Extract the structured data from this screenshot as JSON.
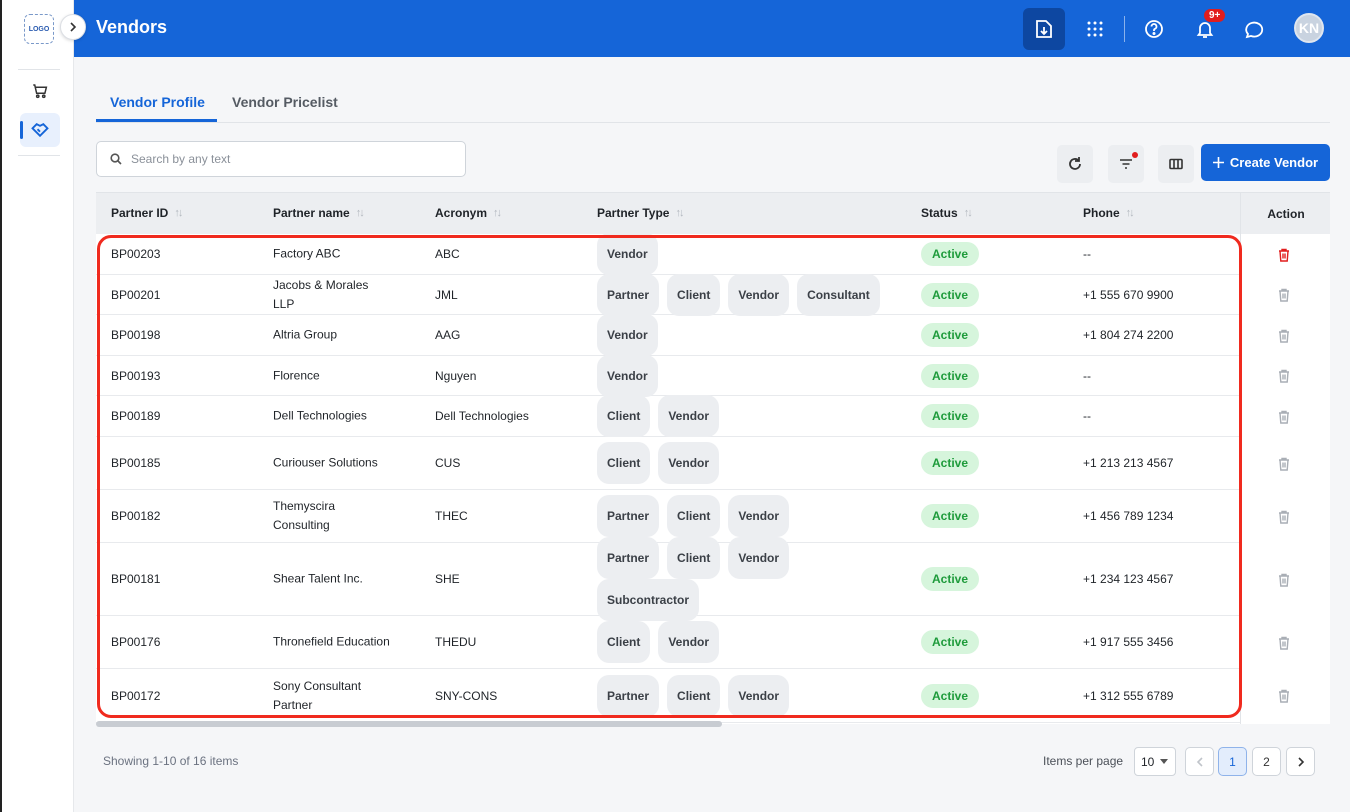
{
  "sidebar": {
    "logo_text": "LOGO",
    "items": [
      {
        "name": "cart",
        "icon": "shopping-cart-icon"
      },
      {
        "name": "vendors",
        "icon": "handshake-icon",
        "active": true
      }
    ]
  },
  "header": {
    "title": "Vendors",
    "notification_badge": "9+",
    "avatar_initials": "KN"
  },
  "tabs": [
    {
      "label": "Vendor Profile",
      "active": true
    },
    {
      "label": "Vendor Pricelist",
      "active": false
    }
  ],
  "search": {
    "placeholder": "Search by any text",
    "value": ""
  },
  "toolbar": {
    "create_label": "Create Vendor"
  },
  "table": {
    "columns": [
      "Partner ID",
      "Partner name",
      "Acronym",
      "Partner Type",
      "Status",
      "Phone",
      "Action"
    ],
    "rows": [
      {
        "id": "BP00203",
        "name": "Factory ABC",
        "acronym": "ABC",
        "types": [
          "Vendor"
        ],
        "status": "Active",
        "phone": "--"
      },
      {
        "id": "BP00201",
        "name": "Jacobs & Morales LLP",
        "acronym": "JML",
        "types": [
          "Partner",
          "Client",
          "Vendor",
          "Consultant"
        ],
        "status": "Active",
        "phone": "+1 555 670 9900"
      },
      {
        "id": "BP00198",
        "name": "Altria Group",
        "acronym": "AAG",
        "types": [
          "Vendor"
        ],
        "status": "Active",
        "phone": "+1 804 274 2200"
      },
      {
        "id": "BP00193",
        "name": "Florence",
        "acronym": "Nguyen",
        "types": [
          "Vendor"
        ],
        "status": "Active",
        "phone": "--"
      },
      {
        "id": "BP00189",
        "name": "Dell Technologies",
        "acronym": "Dell Technologies",
        "types": [
          "Client",
          "Vendor"
        ],
        "status": "Active",
        "phone": "--"
      },
      {
        "id": "BP00185",
        "name": "Curiouser Solutions",
        "acronym": "CUS",
        "types": [
          "Client",
          "Vendor"
        ],
        "status": "Active",
        "phone": "+1 213 213 4567"
      },
      {
        "id": "BP00182",
        "name": "Themyscira Consulting",
        "acronym": "THEC",
        "types": [
          "Partner",
          "Client",
          "Vendor"
        ],
        "status": "Active",
        "phone": "+1 456 789 1234"
      },
      {
        "id": "BP00181",
        "name": "Shear Talent Inc.",
        "acronym": "SHE",
        "types": [
          "Partner",
          "Client",
          "Vendor",
          "Subcontractor"
        ],
        "status": "Active",
        "phone": "+1 234 123 4567"
      },
      {
        "id": "BP00176",
        "name": "Thronefield Education",
        "acronym": "THEDU",
        "types": [
          "Client",
          "Vendor"
        ],
        "status": "Active",
        "phone": "+1 917 555 3456"
      },
      {
        "id": "BP00172",
        "name": "Sony Consultant Partner",
        "acronym": "SNY-CONS",
        "types": [
          "Partner",
          "Client",
          "Vendor"
        ],
        "status": "Active",
        "phone": "+1 312 555 6789"
      }
    ]
  },
  "footer": {
    "showing": "Showing 1-10 of 16 items",
    "items_per_page_label": "Items per page",
    "items_per_page": "10",
    "pages": [
      "1",
      "2"
    ],
    "current_page": "1"
  },
  "colors": {
    "primary": "#1565d8",
    "status_active_bg": "#d6f5dc",
    "status_active_text": "#1e9b3b",
    "danger": "#e11d1d",
    "highlight": "#f02a1e"
  }
}
